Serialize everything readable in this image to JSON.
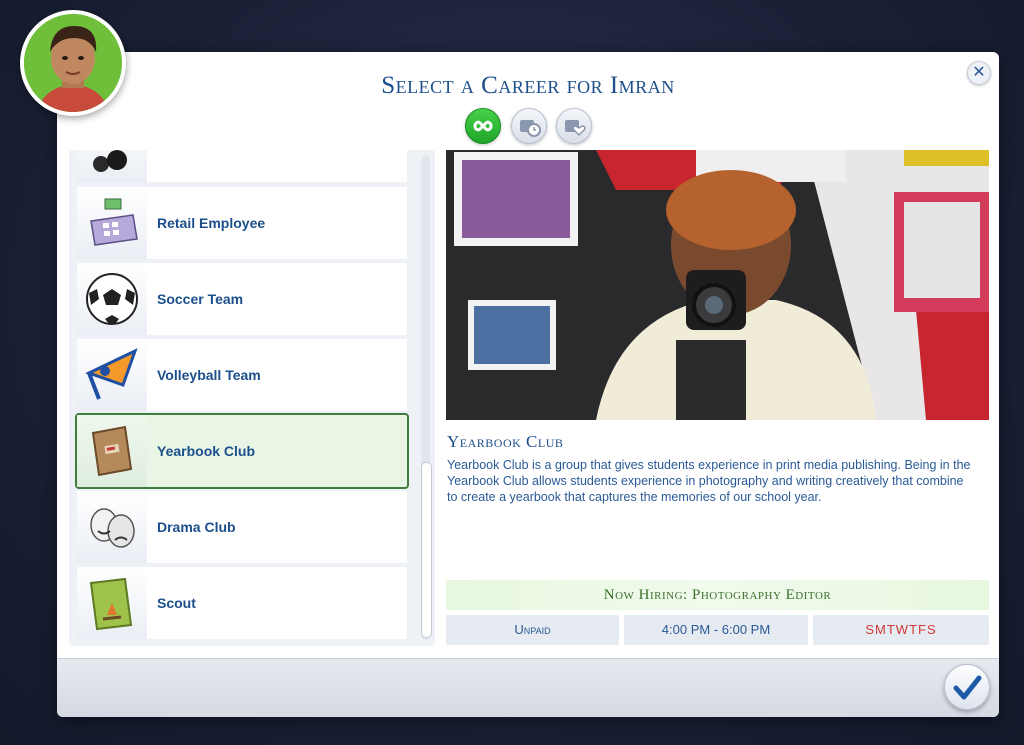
{
  "dialog": {
    "title": "Select a Career for Imran",
    "close_icon": "close-icon",
    "confirm_icon": "checkmark-icon"
  },
  "filters": [
    {
      "icon": "infinity-icon",
      "active": true
    },
    {
      "icon": "part-time-career-icon",
      "active": false
    },
    {
      "icon": "volunteer-career-icon",
      "active": false
    }
  ],
  "careers": [
    {
      "label": "",
      "icon": "bowling-balls-icon"
    },
    {
      "label": "Retail Employee",
      "icon": "cash-register-icon"
    },
    {
      "label": "Soccer Team",
      "icon": "soccer-ball-icon"
    },
    {
      "label": "Volleyball Team",
      "icon": "pennant-icon"
    },
    {
      "label": "Yearbook Club",
      "icon": "yearbook-icon",
      "selected": true
    },
    {
      "label": "Drama Club",
      "icon": "theater-masks-icon"
    },
    {
      "label": "Scout",
      "icon": "scout-handbook-icon"
    }
  ],
  "detail": {
    "name": "Yearbook Club",
    "description": "Yearbook Club is a group that gives students experience in print media publishing. Being in the Yearbook Club allows students experience in photography and writing creatively that combine to create a yearbook that captures the memories of our school year.",
    "hiring": "Now Hiring: Photography Editor",
    "pay": "Unpaid",
    "hours": "4:00 PM - 6:00 PM",
    "days": "SMTWTFS"
  },
  "colors": {
    "title": "#1c4f8c",
    "selected_border": "#3f7d3c",
    "hiring_bg": "#e7f7e0",
    "days": "#d23737"
  }
}
